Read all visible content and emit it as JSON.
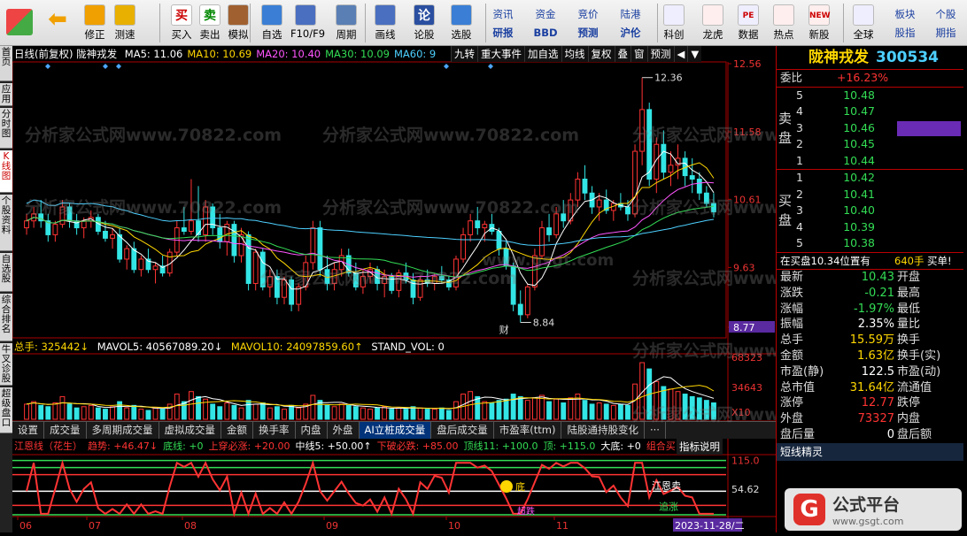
{
  "toolbar": {
    "buttons": [
      {
        "label": "修正",
        "icon": "arrow-up-icon"
      },
      {
        "label": "测速",
        "icon": "speed-icon"
      },
      {
        "label": "买入",
        "icon": "buy-icon",
        "glyph": "买"
      },
      {
        "label": "卖出",
        "icon": "sell-icon",
        "glyph": "卖"
      },
      {
        "label": "模拟",
        "icon": "hammer-icon"
      },
      {
        "label": "自选",
        "icon": "star-icon"
      },
      {
        "label": "F10/F9",
        "icon": "info-icon"
      },
      {
        "label": "周期",
        "icon": "bars-icon"
      },
      {
        "label": "画线",
        "icon": "pen-icon"
      },
      {
        "label": "论股",
        "icon": "discuss-icon",
        "glyph": "论"
      },
      {
        "label": "选股",
        "icon": "select-icon"
      }
    ],
    "small_buttons": [
      [
        "资讯",
        "资金",
        "竞价",
        "陆港"
      ],
      [
        "研报",
        "BBD",
        "预测",
        "沪伦"
      ]
    ],
    "right_buttons": [
      {
        "label": "科创",
        "icon": "chart-icon"
      },
      {
        "label": "龙虎",
        "icon": "dragon-icon"
      },
      {
        "label": "数据",
        "icon": "pe-icon",
        "glyph": "PE"
      },
      {
        "label": "热点",
        "icon": "fire-icon"
      },
      {
        "label": "新股",
        "icon": "new-icon",
        "glyph": "NEW"
      },
      {
        "label": "全球",
        "icon": "globe-icon"
      }
    ],
    "far_right": [
      [
        "板块",
        "股指"
      ],
      [
        "个股",
        "期指"
      ]
    ]
  },
  "side_tabs": [
    "首页",
    "应用",
    "分时图",
    "K线图",
    "个股资料",
    "自选股",
    "综合排名",
    "牛叉诊股",
    "超级盘口"
  ],
  "chart": {
    "period_label": "日线(前复权)",
    "stock_name": "陇神戎发",
    "ma": [
      {
        "label": "MA5: 11.06",
        "color": "#ffffff"
      },
      {
        "label": "MA10: 10.69",
        "color": "#ffd700"
      },
      {
        "label": "MA20: 10.40",
        "color": "#ff55ff"
      },
      {
        "label": "MA30: 10.09",
        "color": "#33dd55"
      },
      {
        "label": "MA60: 9",
        "color": "#4dd0ff"
      }
    ],
    "menu_buttons": [
      "九转",
      "重大事件",
      "加自选",
      "均线",
      "复权",
      "叠",
      "窗",
      "预测",
      "◀",
      "▼"
    ],
    "price_axis": [
      "12.56",
      "11.58",
      "10.61",
      "9.63",
      "8.77"
    ],
    "high_label": "12.36",
    "low_label": "8.84",
    "cai_label": "财",
    "vol_info": {
      "total": "总手: 325442↓",
      "mavol5": "MAVOL5: 40567089.20↓",
      "mavol10": "MAVOL10: 24097859.60↑",
      "stand": "STAND_VOL: 0"
    },
    "vol_axis": [
      "68323",
      "34643",
      "X10"
    ],
    "indicator_tabs": [
      "设置",
      "成交量",
      "多周期成交量",
      "虚拟成交量",
      "金额",
      "换手率",
      "内盘",
      "外盘",
      "AI立桩成交量",
      "盘后成交量",
      "市盈率(ttm)",
      "陆股通持股变化",
      "···"
    ],
    "active_indicator": "AI立桩成交量",
    "ind_info": [
      {
        "text": "江恩线（花生）",
        "color": "#ff3333"
      },
      {
        "text": "趋势: +46.47↓",
        "color": "#ff3333"
      },
      {
        "text": "底线: +0",
        "color": "#33dd55"
      },
      {
        "text": "上穿必涨: +20.00",
        "color": "#ff3333"
      },
      {
        "text": "中线5: +50.00↑",
        "color": "#ffffff"
      },
      {
        "text": "下破必跌: +85.00",
        "color": "#ff3333"
      },
      {
        "text": "顶线11: +100.0",
        "color": "#33dd55"
      },
      {
        "text": "顶: +115.0",
        "color": "#33dd55"
      },
      {
        "text": "大底: +0",
        "color": "#ffffff"
      },
      {
        "text": "组合买: +0",
        "color": "#ff3333"
      }
    ],
    "ind_help": "指标说明",
    "ind_axis": [
      "115.0",
      "54.62"
    ],
    "ind_annotations": {
      "zhang": "涨",
      "di": "底",
      "jdm": "超跌",
      "jian": "江恩卖",
      "up": "追涨"
    },
    "date_axis": [
      "06",
      "07",
      "08",
      "09",
      "10",
      "11"
    ],
    "date_cursor": "2023-11-28/二",
    "watermark": "分析家公式网www.70822.com",
    "watermark2": "www.gsgt.com"
  },
  "chart_data": {
    "type": "candlestick",
    "title": "陇神戎发 日线(前复权)",
    "ylim": [
      8.77,
      12.56
    ],
    "candles": [
      [
        10.2,
        10.4,
        10.1,
        10.3
      ],
      [
        10.3,
        10.5,
        10.2,
        10.4
      ],
      [
        10.4,
        10.6,
        10.2,
        10.3
      ],
      [
        10.3,
        10.4,
        10.0,
        10.1
      ],
      [
        10.1,
        10.3,
        10.0,
        10.25
      ],
      [
        10.25,
        10.6,
        10.2,
        10.5
      ],
      [
        10.5,
        10.55,
        10.2,
        10.3
      ],
      [
        10.3,
        10.4,
        10.1,
        10.2
      ],
      [
        10.2,
        10.35,
        10.05,
        10.3
      ],
      [
        10.3,
        10.45,
        10.2,
        10.35
      ],
      [
        10.35,
        10.4,
        10.1,
        10.15
      ],
      [
        10.15,
        10.3,
        10.0,
        10.05
      ],
      [
        10.05,
        10.2,
        9.9,
        10.1
      ],
      [
        10.1,
        10.2,
        9.7,
        9.75
      ],
      [
        9.75,
        9.95,
        9.6,
        9.9
      ],
      [
        9.9,
        10.0,
        9.55,
        9.6
      ],
      [
        9.6,
        9.8,
        9.5,
        9.75
      ],
      [
        9.75,
        9.9,
        9.55,
        9.6
      ],
      [
        9.6,
        9.7,
        9.4,
        9.65
      ],
      [
        9.65,
        9.8,
        9.5,
        9.55
      ],
      [
        9.55,
        9.9,
        9.5,
        9.85
      ],
      [
        9.85,
        10.3,
        9.8,
        10.2
      ],
      [
        10.2,
        10.5,
        10.1,
        10.15
      ],
      [
        10.15,
        10.9,
        10.1,
        10.3
      ],
      [
        10.3,
        10.8,
        10.0,
        10.1
      ],
      [
        10.1,
        10.6,
        10.0,
        10.5
      ],
      [
        10.5,
        10.55,
        10.1,
        10.2
      ],
      [
        10.2,
        10.4,
        9.9,
        10.0
      ],
      [
        10.0,
        10.3,
        9.8,
        10.25
      ],
      [
        10.25,
        10.3,
        9.7,
        9.8
      ],
      [
        9.8,
        10.2,
        9.7,
        10.1
      ],
      [
        10.1,
        10.15,
        9.3,
        9.4
      ],
      [
        9.4,
        9.9,
        9.3,
        9.85
      ],
      [
        9.85,
        9.9,
        9.3,
        9.35
      ],
      [
        9.35,
        9.6,
        9.2,
        9.5
      ],
      [
        9.5,
        9.6,
        9.1,
        9.2
      ],
      [
        9.2,
        9.5,
        9.1,
        9.45
      ],
      [
        9.45,
        9.5,
        9.0,
        9.1
      ],
      [
        9.1,
        9.4,
        9.0,
        9.35
      ],
      [
        9.35,
        9.8,
        9.3,
        9.7
      ],
      [
        9.7,
        10.3,
        9.6,
        10.2
      ],
      [
        10.2,
        10.3,
        9.5,
        9.6
      ],
      [
        9.6,
        9.8,
        9.3,
        9.4
      ],
      [
        9.4,
        9.7,
        9.3,
        9.6
      ],
      [
        9.6,
        9.9,
        9.5,
        9.8
      ],
      [
        9.8,
        9.9,
        9.5,
        9.55
      ],
      [
        9.55,
        9.7,
        9.3,
        9.35
      ],
      [
        9.35,
        9.6,
        9.25,
        9.5
      ],
      [
        9.5,
        9.7,
        9.4,
        9.6
      ],
      [
        9.6,
        9.65,
        9.3,
        9.4
      ],
      [
        9.4,
        9.6,
        9.2,
        9.5
      ],
      [
        9.5,
        9.55,
        9.25,
        9.3
      ],
      [
        9.3,
        9.6,
        9.2,
        9.55
      ],
      [
        9.55,
        9.7,
        9.4,
        9.45
      ],
      [
        9.45,
        9.55,
        9.1,
        9.2
      ],
      [
        9.2,
        9.5,
        9.15,
        9.45
      ],
      [
        9.45,
        9.6,
        9.35,
        9.4
      ],
      [
        9.4,
        9.55,
        9.3,
        9.5
      ],
      [
        9.5,
        9.65,
        9.4,
        9.45
      ],
      [
        9.45,
        9.5,
        9.3,
        9.35
      ],
      [
        9.35,
        9.8,
        9.3,
        9.75
      ],
      [
        9.75,
        10.2,
        9.7,
        10.1
      ],
      [
        10.1,
        10.4,
        10.0,
        10.3
      ],
      [
        10.3,
        10.5,
        10.1,
        10.2
      ],
      [
        10.2,
        10.3,
        10.0,
        10.25
      ],
      [
        10.25,
        10.4,
        10.1,
        10.15
      ],
      [
        10.15,
        10.2,
        9.8,
        9.9
      ],
      [
        9.9,
        10.0,
        9.6,
        9.65
      ],
      [
        9.65,
        9.7,
        9.0,
        9.1
      ],
      [
        9.1,
        9.3,
        8.84,
        8.95
      ],
      [
        8.95,
        9.4,
        8.9,
        9.35
      ],
      [
        9.35,
        9.9,
        9.3,
        9.8
      ],
      [
        9.8,
        10.3,
        9.75,
        10.2
      ],
      [
        10.2,
        10.4,
        10.0,
        10.1
      ],
      [
        10.1,
        10.5,
        10.05,
        10.4
      ],
      [
        10.4,
        10.6,
        10.2,
        10.3
      ],
      [
        10.3,
        10.7,
        10.25,
        10.6
      ],
      [
        10.6,
        11.0,
        10.5,
        10.9
      ],
      [
        10.9,
        11.1,
        10.6,
        10.7
      ],
      [
        10.7,
        10.8,
        10.4,
        10.5
      ],
      [
        10.5,
        10.7,
        10.3,
        10.6
      ],
      [
        10.6,
        10.75,
        10.4,
        10.45
      ],
      [
        10.45,
        10.6,
        10.3,
        10.55
      ],
      [
        10.55,
        10.7,
        10.45,
        10.5
      ],
      [
        10.5,
        10.6,
        10.3,
        10.4
      ],
      [
        10.4,
        11.4,
        10.35,
        11.3
      ],
      [
        11.3,
        12.36,
        11.1,
        11.9
      ],
      [
        11.9,
        12.0,
        10.8,
        10.9
      ],
      [
        10.9,
        11.5,
        10.7,
        11.4
      ],
      [
        11.4,
        11.6,
        10.9,
        11.0
      ],
      [
        11.0,
        11.3,
        10.8,
        11.1
      ],
      [
        11.1,
        11.4,
        10.9,
        11.2
      ],
      [
        11.2,
        11.3,
        10.8,
        10.95
      ],
      [
        10.95,
        11.2,
        10.7,
        10.9
      ],
      [
        10.9,
        11.0,
        10.6,
        10.7
      ],
      [
        10.7,
        10.8,
        10.5,
        10.55
      ],
      [
        10.55,
        10.7,
        10.35,
        10.43
      ]
    ],
    "volumes": [
      12,
      14,
      11,
      10,
      13,
      18,
      12,
      9,
      10,
      11,
      9,
      8,
      10,
      14,
      9,
      11,
      8,
      7,
      9,
      8,
      12,
      20,
      14,
      22,
      18,
      16,
      12,
      10,
      13,
      11,
      9,
      15,
      12,
      13,
      9,
      10,
      8,
      11,
      9,
      12,
      19,
      15,
      11,
      10,
      12,
      11,
      10,
      9,
      8,
      9,
      10,
      8,
      9,
      8,
      10,
      9,
      8,
      8,
      9,
      7,
      14,
      20,
      22,
      18,
      14,
      13,
      15,
      16,
      20,
      18,
      15,
      17,
      19,
      14,
      16,
      13,
      17,
      20,
      15,
      12,
      13,
      12,
      11,
      12,
      11,
      28,
      45,
      40,
      30,
      26,
      24,
      22,
      20,
      18,
      17,
      15,
      13
    ],
    "ma_series": [
      {
        "name": "MA5",
        "values": [
          10.1,
          10.4,
          10.2,
          9.8,
          9.5,
          9.6,
          10.1,
          9.9,
          9.6,
          9.7,
          9.5,
          9.4,
          9.6,
          10.0,
          9.3,
          10.2,
          10.6,
          10.5,
          11.2,
          11.0
        ]
      },
      {
        "name": "MA60",
        "values": [
          10.5,
          10.4,
          10.3,
          10.1,
          9.9,
          9.8,
          9.75,
          9.7,
          9.6,
          9.55,
          9.5,
          9.55,
          9.6,
          9.65,
          9.7,
          9.8,
          9.9,
          10.0,
          10.1,
          10.3
        ]
      }
    ],
    "indicator_ylim": [
      0,
      120
    ]
  },
  "panel": {
    "stock_name": "陇神戎发",
    "stock_code": "300534",
    "weibi_label": "委比",
    "weibi_value": "+16.23%",
    "sell_label": [
      "卖",
      "盘"
    ],
    "buy_label": [
      "买",
      "盘"
    ],
    "sell": [
      {
        "n": "5",
        "price": "10.48"
      },
      {
        "n": "4",
        "price": "10.47"
      },
      {
        "n": "3",
        "price": "10.46"
      },
      {
        "n": "2",
        "price": "10.45"
      },
      {
        "n": "1",
        "price": "10.44"
      }
    ],
    "buy": [
      {
        "n": "1",
        "price": "10.42"
      },
      {
        "n": "2",
        "price": "10.41"
      },
      {
        "n": "3",
        "price": "10.40"
      },
      {
        "n": "4",
        "price": "10.39"
      },
      {
        "n": "5",
        "price": "10.38"
      }
    ],
    "inbuy": {
      "text": "在买盘10.34位置有",
      "vol": "640手",
      "action": "买单!"
    },
    "stats": [
      {
        "k": "最新",
        "v": "10.43",
        "c": "green",
        "k2": "开盘",
        "v2": ""
      },
      {
        "k": "涨跌",
        "v": "-0.21",
        "c": "green",
        "k2": "最高",
        "v2": ""
      },
      {
        "k": "涨幅",
        "v": "-1.97%",
        "c": "green",
        "k2": "最低",
        "v2": ""
      },
      {
        "k": "振幅",
        "v": "2.35%",
        "c": "white",
        "k2": "量比",
        "v2": ""
      },
      {
        "k": "总手",
        "v": "15.59万",
        "c": "yellow",
        "k2": "换手",
        "v2": ""
      },
      {
        "k": "金额",
        "v": "1.63亿",
        "c": "yellow",
        "k2": "换手(实)",
        "v2": ""
      },
      {
        "k": "市盈(静)",
        "v": "122.5",
        "c": "white",
        "k2": "市盈(动)",
        "v2": ""
      },
      {
        "k": "总市值",
        "v": "31.64亿",
        "c": "yellow",
        "k2": "流通值",
        "v2": ""
      },
      {
        "k": "涨停",
        "v": "12.77",
        "c": "red",
        "k2": "跌停",
        "v2": ""
      },
      {
        "k": "外盘",
        "v": "73327",
        "c": "red",
        "k2": "内盘",
        "v2": ""
      },
      {
        "k": "盘后量",
        "v": "0",
        "c": "white",
        "k2": "盘后额",
        "v2": ""
      }
    ],
    "jx_title": "短线精灵"
  },
  "brand": {
    "logo": "G",
    "name": "公式平台",
    "url": "www.gsgt.com"
  }
}
